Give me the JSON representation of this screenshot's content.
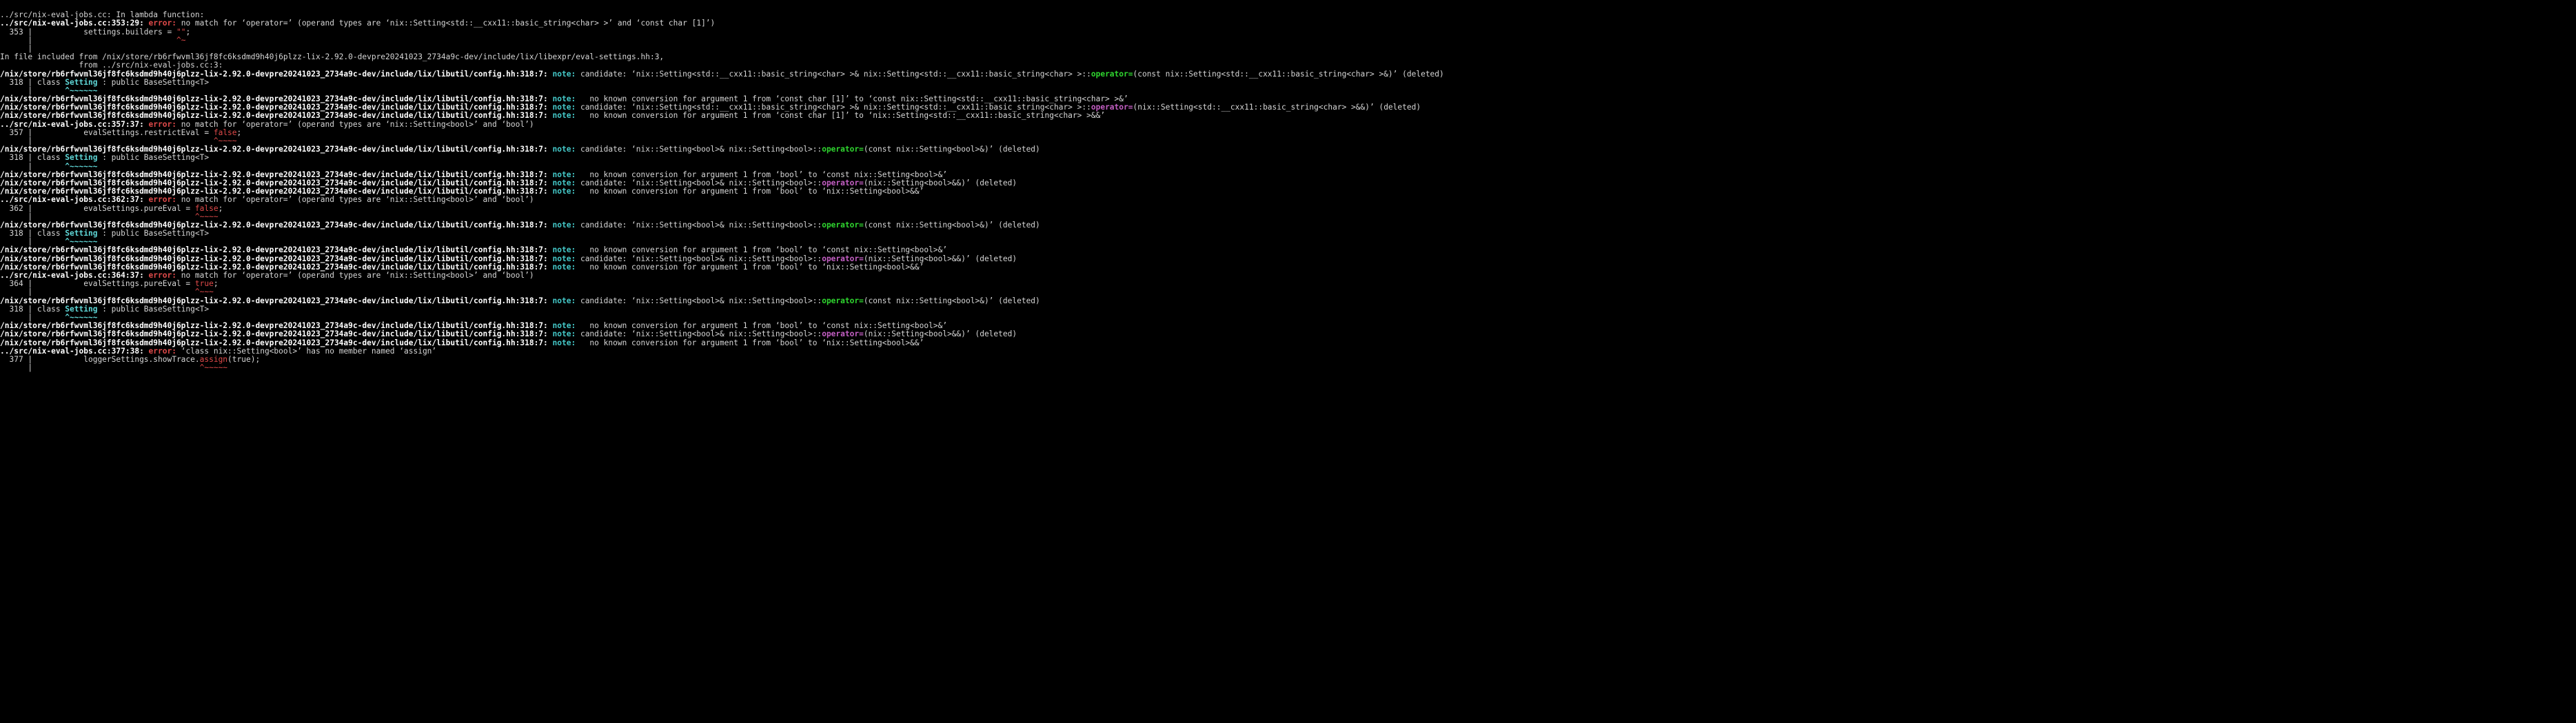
{
  "terminal": {
    "title": "compiler-diagnostics-output",
    "background": "#000000",
    "foreground": "#d6d6d6",
    "colors": {
      "error": "#e04a4a",
      "note": "#44c8c8",
      "green": "#2fd62f",
      "cyan": "#5fd7d7",
      "magenta": "#c45fc4",
      "default": "#d6d6d6",
      "bold_white": "#ffffff"
    },
    "font_size_px": 11.2,
    "line_height_px": 12.2
  },
  "paths": {
    "source": "../src/nix-eval-jobs.cc",
    "nix_store_prefix": "/nix/store/rb6rfwvml36jf8fc6ksdmd9h40j6plzz-lix-2.92.0-devpre20241023_2734a9c-dev",
    "config_header": "/nix/store/rb6rfwvml36jf8fc6ksdmd9h40j6plzz-lix-2.92.0-devpre20241023_2734a9c-dev/include/lix/libutil/config.hh",
    "eval_settings_header": "/nix/store/rb6rfwvml36jf8fc6ksdmd9h40j6plzz-lix-2.92.0-devpre20241023_2734a9c-dev/include/lix/libexpr/eval-settings.hh"
  },
  "lines": [
    {
      "id": 0,
      "segments": []
    },
    {
      "id": 1,
      "segments": [
        {
          "t": "../src/nix-eval-jobs.cc: In lambda function:",
          "c": "c-default"
        }
      ]
    },
    {
      "id": 2,
      "segments": [
        {
          "t": "../src/nix-eval-jobs.cc:353:29: ",
          "c": "c-bold"
        },
        {
          "t": "error: ",
          "c": "c-error"
        },
        {
          "t": "no match for ‘operator=’ (operand types are ‘nix::Setting<std::__cxx11::basic_string<char> >’ and ‘const char [1]’)",
          "c": "c-default"
        }
      ]
    },
    {
      "id": 3,
      "segments": [
        {
          "t": "  353 |           settings.builders = ",
          "c": "c-default"
        },
        {
          "t": "\"\"",
          "c": "c-red"
        },
        {
          "t": ";",
          "c": "c-default"
        }
      ]
    },
    {
      "id": 4,
      "segments": [
        {
          "t": "      |                               ",
          "c": "c-default"
        },
        {
          "t": "^~",
          "c": "c-red"
        }
      ]
    },
    {
      "id": 5,
      "segments": [
        {
          "t": "      |",
          "c": "c-default"
        }
      ]
    },
    {
      "id": 6,
      "segments": [
        {
          "t": "In file included from /nix/store/rb6rfwvml36jf8fc6ksdmd9h40j6plzz-lix-2.92.0-devpre20241023_2734a9c-dev/include/lix/libexpr/eval-settings.hh:3,",
          "c": "c-default"
        }
      ]
    },
    {
      "id": 7,
      "segments": [
        {
          "t": "                 from ../src/nix-eval-jobs.cc:3:",
          "c": "c-default"
        }
      ]
    },
    {
      "id": 8,
      "segments": [
        {
          "t": "/nix/store/rb6rfwvml36jf8fc6ksdmd9h40j6plzz-lix-2.92.0-devpre20241023_2734a9c-dev/include/lix/libutil/config.hh:318:7: ",
          "c": "c-bold"
        },
        {
          "t": "note: ",
          "c": "c-note"
        },
        {
          "t": "candidate: ‘nix::Setting<std::__cxx11::basic_string<char> >& nix::Setting<std::__cxx11::basic_string<char> >::",
          "c": "c-default"
        },
        {
          "t": "operator=",
          "c": "c-green"
        },
        {
          "t": "(const nix::Setting<std::__cxx11::basic_string<char> >&)’ (deleted)",
          "c": "c-default"
        }
      ]
    },
    {
      "id": 9,
      "segments": [
        {
          "t": "  318 | class ",
          "c": "c-default"
        },
        {
          "t": "Setting",
          "c": "c-cyan"
        },
        {
          "t": " : public BaseSetting<T>",
          "c": "c-default"
        }
      ]
    },
    {
      "id": 10,
      "segments": [
        {
          "t": "      |       ",
          "c": "c-default"
        },
        {
          "t": "^~~~~~~",
          "c": "c-cyan"
        }
      ]
    },
    {
      "id": 11,
      "segments": [
        {
          "t": "/nix/store/rb6rfwvml36jf8fc6ksdmd9h40j6plzz-lix-2.92.0-devpre20241023_2734a9c-dev/include/lix/libutil/config.hh:318:7: ",
          "c": "c-bold"
        },
        {
          "t": "note: ",
          "c": "c-note"
        },
        {
          "t": "  no known conversion for argument 1 from ‘const char [1]’ to ‘const nix::Setting<std::__cxx11::basic_string<char> >&’",
          "c": "c-default"
        }
      ]
    },
    {
      "id": 12,
      "segments": [
        {
          "t": "/nix/store/rb6rfwvml36jf8fc6ksdmd9h40j6plzz-lix-2.92.0-devpre20241023_2734a9c-dev/include/lix/libutil/config.hh:318:7: ",
          "c": "c-bold"
        },
        {
          "t": "note: ",
          "c": "c-note"
        },
        {
          "t": "candidate: ‘nix::Setting<std::__cxx11::basic_string<char> >& nix::Setting<std::__cxx11::basic_string<char> >::",
          "c": "c-default"
        },
        {
          "t": "operator=",
          "c": "c-magenta"
        },
        {
          "t": "(nix::Setting<std::__cxx11::basic_string<char> >&&)’ (deleted)",
          "c": "c-default"
        }
      ]
    },
    {
      "id": 13,
      "segments": [
        {
          "t": "/nix/store/rb6rfwvml36jf8fc6ksdmd9h40j6plzz-lix-2.92.0-devpre20241023_2734a9c-dev/include/lix/libutil/config.hh:318:7: ",
          "c": "c-bold"
        },
        {
          "t": "note: ",
          "c": "c-note"
        },
        {
          "t": "  no known conversion for argument 1 from ‘const char [1]’ to ‘nix::Setting<std::__cxx11::basic_string<char> >&&’",
          "c": "c-default"
        }
      ]
    },
    {
      "id": 14,
      "segments": [
        {
          "t": "../src/nix-eval-jobs.cc:357:37: ",
          "c": "c-bold"
        },
        {
          "t": "error: ",
          "c": "c-error"
        },
        {
          "t": "no match for ‘operator=’ (operand types are ‘nix::Setting<bool>’ and ‘bool’)",
          "c": "c-default"
        }
      ]
    },
    {
      "id": 15,
      "segments": [
        {
          "t": "  357 |           evalSettings.restrictEval = ",
          "c": "c-default"
        },
        {
          "t": "false",
          "c": "c-red"
        },
        {
          "t": ";",
          "c": "c-default"
        }
      ]
    },
    {
      "id": 16,
      "segments": [
        {
          "t": "      |                                       ",
          "c": "c-default"
        },
        {
          "t": "^~~~~",
          "c": "c-red"
        }
      ]
    },
    {
      "id": 17,
      "segments": [
        {
          "t": "/nix/store/rb6rfwvml36jf8fc6ksdmd9h40j6plzz-lix-2.92.0-devpre20241023_2734a9c-dev/include/lix/libutil/config.hh:318:7: ",
          "c": "c-bold"
        },
        {
          "t": "note: ",
          "c": "c-note"
        },
        {
          "t": "candidate: ‘nix::Setting<bool>& nix::Setting<bool>::",
          "c": "c-default"
        },
        {
          "t": "operator=",
          "c": "c-green"
        },
        {
          "t": "(const nix::Setting<bool>&)’ (deleted)",
          "c": "c-default"
        }
      ]
    },
    {
      "id": 18,
      "segments": [
        {
          "t": "  318 | class ",
          "c": "c-default"
        },
        {
          "t": "Setting",
          "c": "c-cyan"
        },
        {
          "t": " : public BaseSetting<T>",
          "c": "c-default"
        }
      ]
    },
    {
      "id": 19,
      "segments": [
        {
          "t": "      |       ",
          "c": "c-default"
        },
        {
          "t": "^~~~~~~",
          "c": "c-cyan"
        }
      ]
    },
    {
      "id": 20,
      "segments": [
        {
          "t": "/nix/store/rb6rfwvml36jf8fc6ksdmd9h40j6plzz-lix-2.92.0-devpre20241023_2734a9c-dev/include/lix/libutil/config.hh:318:7: ",
          "c": "c-bold"
        },
        {
          "t": "note: ",
          "c": "c-note"
        },
        {
          "t": "  no known conversion for argument 1 from ‘bool’ to ‘const nix::Setting<bool>&’",
          "c": "c-default"
        }
      ]
    },
    {
      "id": 21,
      "segments": [
        {
          "t": "/nix/store/rb6rfwvml36jf8fc6ksdmd9h40j6plzz-lix-2.92.0-devpre20241023_2734a9c-dev/include/lix/libutil/config.hh:318:7: ",
          "c": "c-bold"
        },
        {
          "t": "note: ",
          "c": "c-note"
        },
        {
          "t": "candidate: ‘nix::Setting<bool>& nix::Setting<bool>::",
          "c": "c-default"
        },
        {
          "t": "operator=",
          "c": "c-magenta"
        },
        {
          "t": "(nix::Setting<bool>&&)’ (deleted)",
          "c": "c-default"
        }
      ]
    },
    {
      "id": 22,
      "segments": [
        {
          "t": "/nix/store/rb6rfwvml36jf8fc6ksdmd9h40j6plzz-lix-2.92.0-devpre20241023_2734a9c-dev/include/lix/libutil/config.hh:318:7: ",
          "c": "c-bold"
        },
        {
          "t": "note: ",
          "c": "c-note"
        },
        {
          "t": "  no known conversion for argument 1 from ‘bool’ to ‘nix::Setting<bool>&&’",
          "c": "c-default"
        }
      ]
    },
    {
      "id": 23,
      "segments": [
        {
          "t": "../src/nix-eval-jobs.cc:362:37: ",
          "c": "c-bold"
        },
        {
          "t": "error: ",
          "c": "c-error"
        },
        {
          "t": "no match for ‘operator=’ (operand types are ‘nix::Setting<bool>’ and ‘bool’)",
          "c": "c-default"
        }
      ]
    },
    {
      "id": 24,
      "segments": [
        {
          "t": "  362 |           evalSettings.pureEval = ",
          "c": "c-default"
        },
        {
          "t": "false",
          "c": "c-red"
        },
        {
          "t": ";",
          "c": "c-default"
        }
      ]
    },
    {
      "id": 25,
      "segments": [
        {
          "t": "      |                                   ",
          "c": "c-default"
        },
        {
          "t": "^~~~~",
          "c": "c-red"
        }
      ]
    },
    {
      "id": 26,
      "segments": [
        {
          "t": "/nix/store/rb6rfwvml36jf8fc6ksdmd9h40j6plzz-lix-2.92.0-devpre20241023_2734a9c-dev/include/lix/libutil/config.hh:318:7: ",
          "c": "c-bold"
        },
        {
          "t": "note: ",
          "c": "c-note"
        },
        {
          "t": "candidate: ‘nix::Setting<bool>& nix::Setting<bool>::",
          "c": "c-default"
        },
        {
          "t": "operator=",
          "c": "c-green"
        },
        {
          "t": "(const nix::Setting<bool>&)’ (deleted)",
          "c": "c-default"
        }
      ]
    },
    {
      "id": 27,
      "segments": [
        {
          "t": "  318 | class ",
          "c": "c-default"
        },
        {
          "t": "Setting",
          "c": "c-cyan"
        },
        {
          "t": " : public BaseSetting<T>",
          "c": "c-default"
        }
      ]
    },
    {
      "id": 28,
      "segments": [
        {
          "t": "      |       ",
          "c": "c-default"
        },
        {
          "t": "^~~~~~~",
          "c": "c-cyan"
        }
      ]
    },
    {
      "id": 29,
      "segments": [
        {
          "t": "/nix/store/rb6rfwvml36jf8fc6ksdmd9h40j6plzz-lix-2.92.0-devpre20241023_2734a9c-dev/include/lix/libutil/config.hh:318:7: ",
          "c": "c-bold"
        },
        {
          "t": "note: ",
          "c": "c-note"
        },
        {
          "t": "  no known conversion for argument 1 from ‘bool’ to ‘const nix::Setting<bool>&’",
          "c": "c-default"
        }
      ]
    },
    {
      "id": 30,
      "segments": [
        {
          "t": "/nix/store/rb6rfwvml36jf8fc6ksdmd9h40j6plzz-lix-2.92.0-devpre20241023_2734a9c-dev/include/lix/libutil/config.hh:318:7: ",
          "c": "c-bold"
        },
        {
          "t": "note: ",
          "c": "c-note"
        },
        {
          "t": "candidate: ‘nix::Setting<bool>& nix::Setting<bool>::",
          "c": "c-default"
        },
        {
          "t": "operator=",
          "c": "c-magenta"
        },
        {
          "t": "(nix::Setting<bool>&&)’ (deleted)",
          "c": "c-default"
        }
      ]
    },
    {
      "id": 31,
      "segments": [
        {
          "t": "/nix/store/rb6rfwvml36jf8fc6ksdmd9h40j6plzz-lix-2.92.0-devpre20241023_2734a9c-dev/include/lix/libutil/config.hh:318:7: ",
          "c": "c-bold"
        },
        {
          "t": "note: ",
          "c": "c-note"
        },
        {
          "t": "  no known conversion for argument 1 from ‘bool’ to ‘nix::Setting<bool>&&’",
          "c": "c-default"
        }
      ]
    },
    {
      "id": 32,
      "segments": [
        {
          "t": "../src/nix-eval-jobs.cc:364:37: ",
          "c": "c-bold"
        },
        {
          "t": "error: ",
          "c": "c-error"
        },
        {
          "t": "no match for ‘operator=’ (operand types are ‘nix::Setting<bool>’ and ‘bool’)",
          "c": "c-default"
        }
      ]
    },
    {
      "id": 33,
      "segments": [
        {
          "t": "  364 |           evalSettings.pureEval = ",
          "c": "c-default"
        },
        {
          "t": "true",
          "c": "c-red"
        },
        {
          "t": ";",
          "c": "c-default"
        }
      ]
    },
    {
      "id": 34,
      "segments": [
        {
          "t": "      |                                   ",
          "c": "c-default"
        },
        {
          "t": "^~~~",
          "c": "c-red"
        }
      ]
    },
    {
      "id": 35,
      "segments": [
        {
          "t": "/nix/store/rb6rfwvml36jf8fc6ksdmd9h40j6plzz-lix-2.92.0-devpre20241023_2734a9c-dev/include/lix/libutil/config.hh:318:7: ",
          "c": "c-bold"
        },
        {
          "t": "note: ",
          "c": "c-note"
        },
        {
          "t": "candidate: ‘nix::Setting<bool>& nix::Setting<bool>::",
          "c": "c-default"
        },
        {
          "t": "operator=",
          "c": "c-green"
        },
        {
          "t": "(const nix::Setting<bool>&)’ (deleted)",
          "c": "c-default"
        }
      ]
    },
    {
      "id": 36,
      "segments": [
        {
          "t": "  318 | class ",
          "c": "c-default"
        },
        {
          "t": "Setting",
          "c": "c-cyan"
        },
        {
          "t": " : public BaseSetting<T>",
          "c": "c-default"
        }
      ]
    },
    {
      "id": 37,
      "segments": [
        {
          "t": "      |       ",
          "c": "c-default"
        },
        {
          "t": "^~~~~~~",
          "c": "c-cyan"
        }
      ]
    },
    {
      "id": 38,
      "segments": [
        {
          "t": "/nix/store/rb6rfwvml36jf8fc6ksdmd9h40j6plzz-lix-2.92.0-devpre20241023_2734a9c-dev/include/lix/libutil/config.hh:318:7: ",
          "c": "c-bold"
        },
        {
          "t": "note: ",
          "c": "c-note"
        },
        {
          "t": "  no known conversion for argument 1 from ‘bool’ to ‘const nix::Setting<bool>&’",
          "c": "c-default"
        }
      ]
    },
    {
      "id": 39,
      "segments": [
        {
          "t": "/nix/store/rb6rfwvml36jf8fc6ksdmd9h40j6plzz-lix-2.92.0-devpre20241023_2734a9c-dev/include/lix/libutil/config.hh:318:7: ",
          "c": "c-bold"
        },
        {
          "t": "note: ",
          "c": "c-note"
        },
        {
          "t": "candidate: ‘nix::Setting<bool>& nix::Setting<bool>::",
          "c": "c-default"
        },
        {
          "t": "operator=",
          "c": "c-magenta"
        },
        {
          "t": "(nix::Setting<bool>&&)’ (deleted)",
          "c": "c-default"
        }
      ]
    },
    {
      "id": 40,
      "segments": [
        {
          "t": "/nix/store/rb6rfwvml36jf8fc6ksdmd9h40j6plzz-lix-2.92.0-devpre20241023_2734a9c-dev/include/lix/libutil/config.hh:318:7: ",
          "c": "c-bold"
        },
        {
          "t": "note: ",
          "c": "c-note"
        },
        {
          "t": "  no known conversion for argument 1 from ‘bool’ to ‘nix::Setting<bool>&&’",
          "c": "c-default"
        }
      ]
    },
    {
      "id": 41,
      "segments": [
        {
          "t": "../src/nix-eval-jobs.cc:377:38: ",
          "c": "c-bold"
        },
        {
          "t": "error: ",
          "c": "c-error"
        },
        {
          "t": "‘class nix::Setting<bool>’ has no member named ‘assign’",
          "c": "c-default"
        }
      ]
    },
    {
      "id": 42,
      "segments": [
        {
          "t": "  377 |           loggerSettings.showTrace.",
          "c": "c-default"
        },
        {
          "t": "assign",
          "c": "c-red"
        },
        {
          "t": "(true);",
          "c": "c-default"
        }
      ]
    },
    {
      "id": 43,
      "segments": [
        {
          "t": "      |                                    ",
          "c": "c-default"
        },
        {
          "t": "^~~~~~",
          "c": "c-red"
        }
      ]
    }
  ]
}
